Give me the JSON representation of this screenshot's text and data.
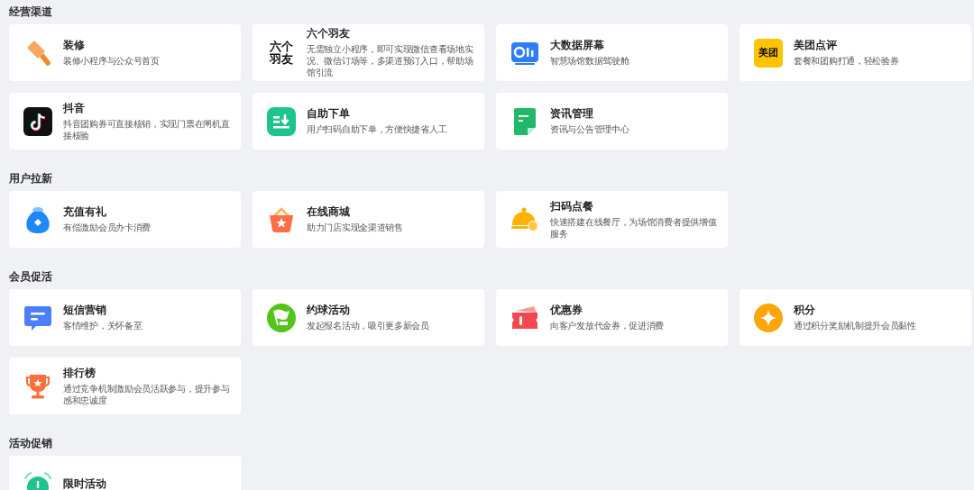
{
  "sections": [
    {
      "title": "经营渠道",
      "cards": [
        {
          "kind": "brush",
          "title": "装修",
          "description": "装修小程序与公众号首页"
        },
        {
          "kind": "text-logo",
          "logo_text": "六个羽友",
          "title": "六个羽友",
          "description": "无需独立小程序，即可实现微信查看场地实况、微信订场等，多渠道预订入口，帮助场馆引流"
        },
        {
          "kind": "screen",
          "title": "大数据屏幕",
          "description": "智慧场馆数据驾驶舱"
        },
        {
          "kind": "yellow-logo",
          "logo_text": "美团",
          "title": "美团点评",
          "description": "套餐和团购打通，轻松验券"
        },
        {
          "kind": "music-note",
          "title": "抖音",
          "description": "抖音团购券可直接核销，实现门票在闸机直接核验"
        },
        {
          "kind": "download-list",
          "title": "自助下单",
          "description": "用户扫码自助下单，方便快捷省人工"
        },
        {
          "kind": "document",
          "title": "资讯管理",
          "description": "资讯与公告管理中心"
        }
      ]
    },
    {
      "title": "用户拉新",
      "cards": [
        {
          "kind": "money-bag",
          "title": "充值有礼",
          "description": "有偿激励会员办卡消费"
        },
        {
          "kind": "basket",
          "title": "在线商城",
          "description": "助力门店实现全渠道销售"
        },
        {
          "kind": "cloche",
          "title": "扫码点餐",
          "description": "快速搭建在线餐厅，为场馆消费者提供增值服务"
        }
      ]
    },
    {
      "title": "会员促活",
      "cards": [
        {
          "kind": "chat",
          "title": "短信营销",
          "description": "客情维护，关怀备至"
        },
        {
          "kind": "flag",
          "title": "约球活动",
          "description": "发起报名活动，吸引更多新会员"
        },
        {
          "kind": "ticket",
          "title": "优惠券",
          "description": "向客户发放代金券，促进消费"
        },
        {
          "kind": "diamond",
          "title": "积分",
          "description": "通过积分奖励机制提升会员黏性"
        },
        {
          "kind": "trophy",
          "title": "排行榜",
          "description": "通过竞争机制激励会员活跃参与，提升参与感和忠诚度"
        }
      ]
    },
    {
      "title": "活动促销",
      "cards": [
        {
          "kind": "alarm",
          "title": "限时活动"
        }
      ]
    }
  ]
}
